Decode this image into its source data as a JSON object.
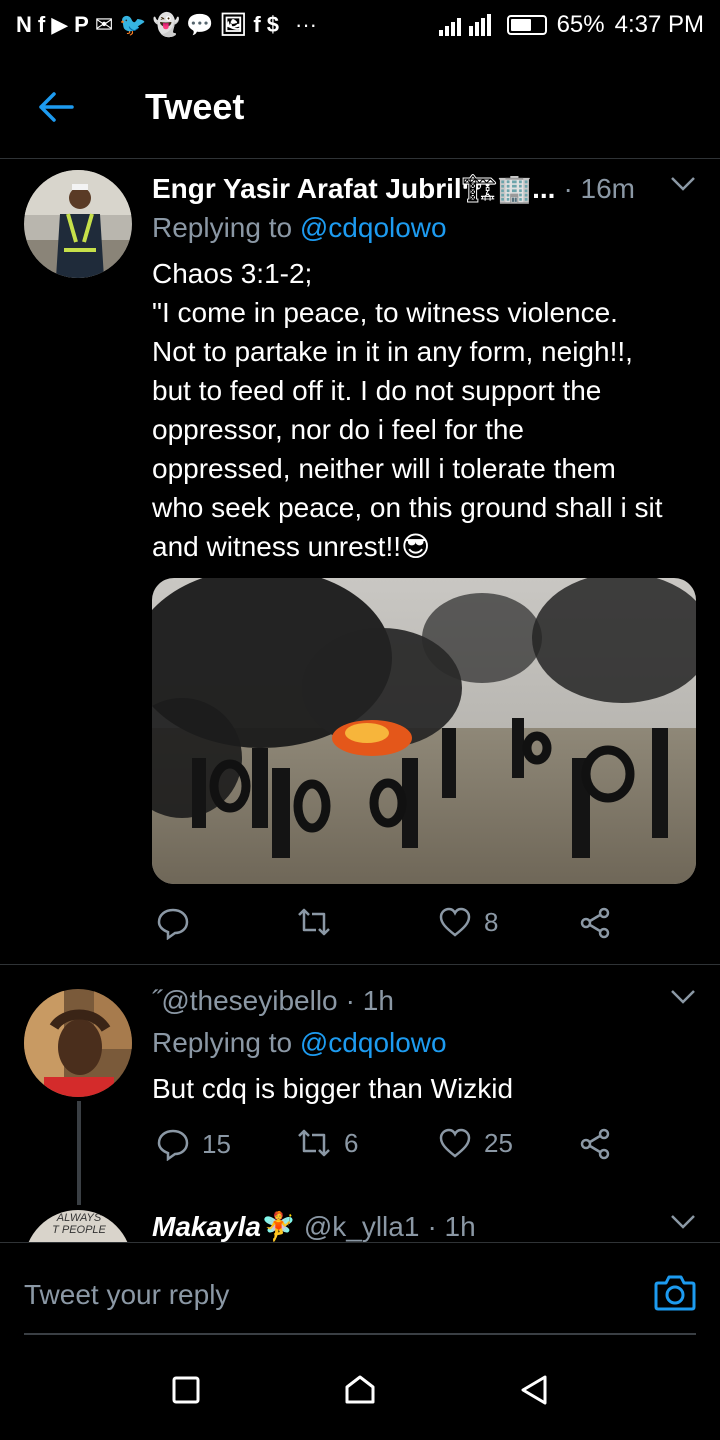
{
  "status_bar": {
    "left_icons": [
      "notification-icons"
    ],
    "ellipsis": "···",
    "battery": "65%",
    "battery_level": 0.65,
    "time": "4:37 PM"
  },
  "header": {
    "title": "Tweet"
  },
  "tweets": [
    {
      "name": "Engr Yasir Arafat Jubril",
      "emoji": "🏗🏢",
      "truncation": "...",
      "time": "· 16m",
      "replying_prefix": "Replying to ",
      "replying_to": "@cdqolowo",
      "text_lines": [
        "Chaos 3:1-2;",
        "\"I come in peace, to witness violence.",
        "Not to partake in it in any form, neigh!!,",
        "but to feed off it. I do not support the",
        "oppressor, nor do i feel for the",
        "oppressed, neither will i tolerate them",
        "who seek peace, on this ground shall i sit",
        "and witness unrest!!😎"
      ],
      "likes": "8"
    },
    {
      "handle_prefix": "˝",
      "handle": "@theseyibello",
      "time": "· 1h",
      "replying_prefix": "Replying to ",
      "replying_to": "@cdqolowo",
      "text": "But cdq is bigger than Wizkid",
      "replies": "15",
      "retweets": "6",
      "likes": "25"
    },
    {
      "name": "Makayla",
      "emoji": "🧚",
      "handle": "@k_ylla1",
      "time": "· 1h",
      "avatar_text": "ALWAYS\nT PEOPLE"
    }
  ],
  "reply_bar": {
    "placeholder": "Tweet your reply"
  },
  "colors": {
    "accent": "#1d9bf0",
    "muted": "#8b98a5",
    "background": "#000000",
    "divider": "#2f3336"
  },
  "icons": [
    "back-arrow-icon",
    "reply-icon",
    "retweet-icon",
    "like-icon",
    "share-icon",
    "chevron-down-icon",
    "camera-icon",
    "square-nav-icon",
    "home-nav-icon",
    "back-nav-icon"
  ]
}
